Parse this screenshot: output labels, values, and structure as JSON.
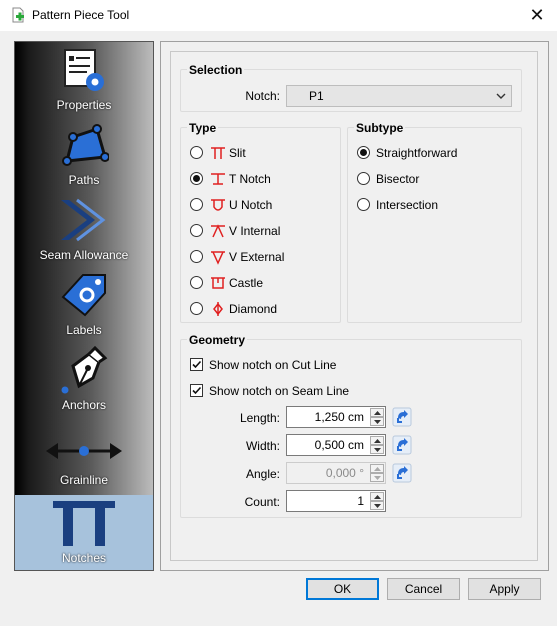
{
  "window": {
    "title": "Pattern Piece Tool",
    "close_glyph": "✕"
  },
  "sidebar": {
    "items": [
      {
        "label": "Properties",
        "icon": "properties-icon"
      },
      {
        "label": "Paths",
        "icon": "paths-icon"
      },
      {
        "label": "Seam Allowance",
        "icon": "seam-allowance-icon"
      },
      {
        "label": "Labels",
        "icon": "labels-icon"
      },
      {
        "label": "Anchors",
        "icon": "anchors-icon"
      },
      {
        "label": "Grainline",
        "icon": "grainline-icon"
      },
      {
        "label": "Notches",
        "icon": "notches-icon",
        "selected": true
      }
    ]
  },
  "selection": {
    "title": "Selection",
    "notch_label": "Notch:",
    "notch_value": "P1"
  },
  "type_group": {
    "title": "Type",
    "options": [
      {
        "label": "Slit",
        "icon": "slit-icon",
        "checked": false
      },
      {
        "label": "T Notch",
        "icon": "t-notch-icon",
        "checked": true
      },
      {
        "label": "U Notch",
        "icon": "u-notch-icon",
        "checked": false
      },
      {
        "label": "V Internal",
        "icon": "v-internal-icon",
        "checked": false
      },
      {
        "label": "V External",
        "icon": "v-external-icon",
        "checked": false
      },
      {
        "label": "Castle",
        "icon": "castle-icon",
        "checked": false
      },
      {
        "label": "Diamond",
        "icon": "diamond-icon",
        "checked": false
      }
    ]
  },
  "subtype_group": {
    "title": "Subtype",
    "options": [
      {
        "label": "Straightforward",
        "checked": true
      },
      {
        "label": "Bisector",
        "checked": false
      },
      {
        "label": "Intersection",
        "checked": false
      }
    ]
  },
  "geometry": {
    "title": "Geometry",
    "show_cut_line": {
      "label": "Show notch on Cut Line",
      "checked": true
    },
    "show_seam_line": {
      "label": "Show notch on Seam Line",
      "checked": true
    },
    "length": {
      "label": "Length:",
      "value": "1,250 cm"
    },
    "width": {
      "label": "Width:",
      "value": "0,500 cm"
    },
    "angle": {
      "label": "Angle:",
      "value": "0,000 °",
      "disabled": true
    },
    "count": {
      "label": "Count:",
      "value": "1"
    }
  },
  "buttons": {
    "ok": "OK",
    "cancel": "Cancel",
    "apply": "Apply"
  },
  "colors": {
    "accent": "#0078d7",
    "notch_icon_red": "#e02020",
    "selected_item_bg": "#a7c2dc",
    "icon_blue": "#2a6fd6"
  }
}
